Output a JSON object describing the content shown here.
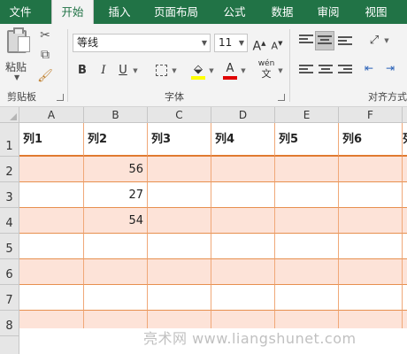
{
  "menu": {
    "tabs": [
      {
        "label": "文件",
        "active": false
      },
      {
        "label": "开始",
        "active": true
      },
      {
        "label": "插入",
        "active": false
      },
      {
        "label": "页面布局",
        "active": false
      },
      {
        "label": "公式",
        "active": false
      },
      {
        "label": "数据",
        "active": false
      },
      {
        "label": "审阅",
        "active": false
      },
      {
        "label": "视图",
        "active": false
      }
    ]
  },
  "ribbon": {
    "clipboard": {
      "paste_label": "粘贴",
      "group_label": "剪贴板"
    },
    "font": {
      "font_name": "等线",
      "font_size": "11",
      "bold": "B",
      "italic": "I",
      "underline": "U",
      "grow": "A",
      "shrink": "A",
      "font_color_letter": "A",
      "pinyin": "wén",
      "group_label": "字体",
      "highlight_color": "#ffff00",
      "font_color": "#e00000"
    },
    "alignment": {
      "group_label": "对齐方式"
    }
  },
  "sheet": {
    "columns": [
      "A",
      "B",
      "C",
      "D",
      "E",
      "F"
    ],
    "rows": [
      "1",
      "2",
      "3",
      "4",
      "5",
      "6",
      "7",
      "8"
    ],
    "header_row": [
      "列1",
      "列2",
      "列3",
      "列4",
      "列5",
      "列6",
      "列"
    ],
    "data": [
      [
        "",
        "56",
        "",
        "",
        "",
        ""
      ],
      [
        "",
        "27",
        "",
        "",
        "",
        ""
      ],
      [
        "",
        "54",
        "",
        "",
        "",
        ""
      ],
      [
        "",
        "",
        "",
        "",
        "",
        ""
      ],
      [
        "",
        "",
        "",
        "",
        "",
        ""
      ],
      [
        "",
        "",
        "",
        "",
        "",
        ""
      ],
      [
        "",
        "",
        "",
        "",
        "",
        ""
      ]
    ],
    "band_color": "#fde3d8",
    "border_color": "#e7904f"
  },
  "watermark": "亮术网 www.liangshunet.com"
}
